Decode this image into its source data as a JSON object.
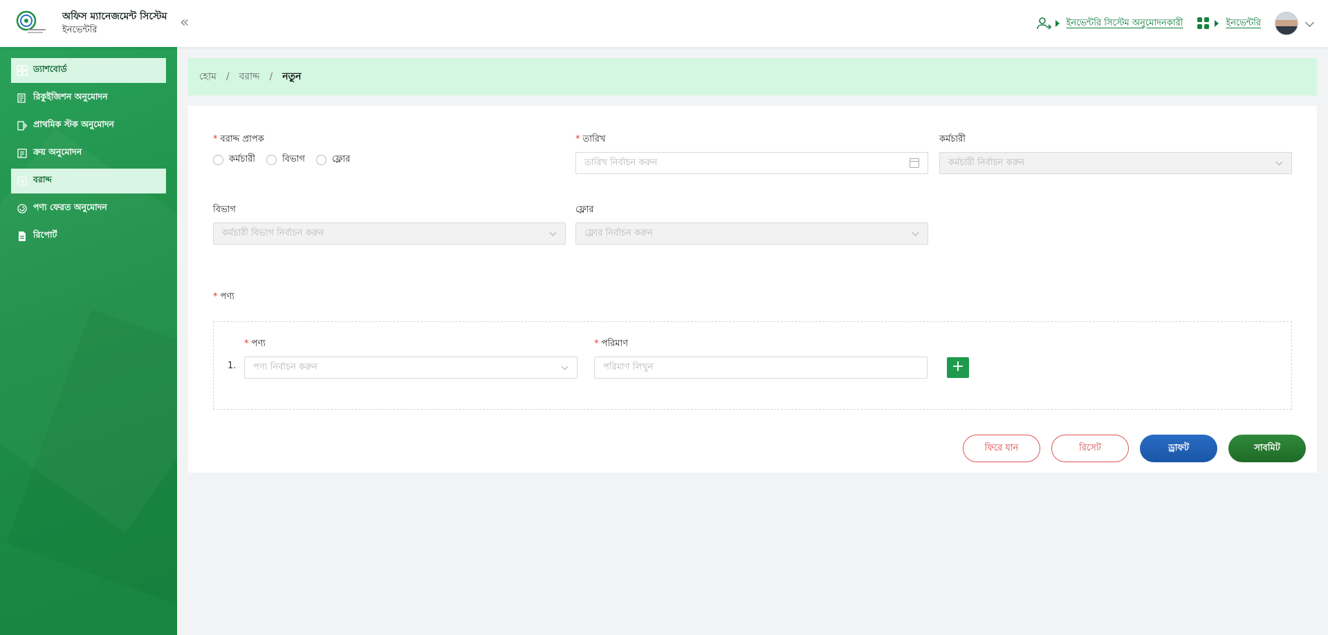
{
  "header": {
    "title": "অফিস ম্যানেজমেন্ট সিস্টেম",
    "subtitle": "ইনভেন্টরি",
    "collapse_glyph": "«",
    "role_link": "ইনভেন্টরি সিস্টেম অনুমোদনকারী",
    "module_link": "ইনভেন্টরি"
  },
  "sidebar": {
    "items": [
      {
        "label": "ড্যাশবোর্ড",
        "icon": "dashboard-icon"
      },
      {
        "label": "রিকুইজিশন অনুমোদন",
        "icon": "requisition-icon"
      },
      {
        "label": "প্রাথমিক স্টক অনুমোদন",
        "icon": "stock-icon"
      },
      {
        "label": "ক্রয় অনুমোদন",
        "icon": "purchase-icon"
      },
      {
        "label": "বরাদ্দ",
        "icon": "allocation-icon"
      },
      {
        "label": "পণ্য ফেরত অনুমোদন",
        "icon": "return-icon"
      },
      {
        "label": "রিপোর্ট",
        "icon": "report-icon"
      }
    ],
    "active_index": 4,
    "highlight_color": "#d9f5e3"
  },
  "breadcrumb": {
    "home": "হোম",
    "section": "বরাদ্দ",
    "current": "নতুন",
    "separator": "/"
  },
  "form": {
    "required_mark": "*",
    "recipient": {
      "label": "বরাদ্দ প্রাপক",
      "options": [
        "কর্মচারী",
        "বিভাগ",
        "ফ্লোর"
      ]
    },
    "date": {
      "label": "তারিখ",
      "placeholder": "তারিখ নির্বাচন করুন"
    },
    "employee": {
      "label": "কর্মচারী",
      "placeholder": "কর্মচারী নির্বাচন করুন"
    },
    "department": {
      "label": "বিভাগ",
      "placeholder": "কর্মচারী বিভাগ নির্বাচন করুন"
    },
    "floor": {
      "label": "ফ্লোর",
      "placeholder": "ফ্লোর নির্বাচন করুন"
    },
    "products_label": "পণ্য",
    "product_row": {
      "index": "1.",
      "product_label": "পণ্য",
      "product_placeholder": "পণ্য নির্বাচন করুন",
      "quantity_label": "পরিমাণ",
      "quantity_placeholder": "পরিমাণ লিখুন",
      "add_glyph": "+"
    }
  },
  "actions": {
    "back": "ফিরে যান",
    "reset": "রিসেট",
    "draft": "ড্রাফট",
    "submit": "সাবমিট"
  },
  "colors": {
    "sidebar": "#1e8e46",
    "breadcrumb_bg": "#d3f7e1",
    "draft": "#1a56a8",
    "submit": "#1f6b27",
    "danger": "#d83b3b"
  }
}
